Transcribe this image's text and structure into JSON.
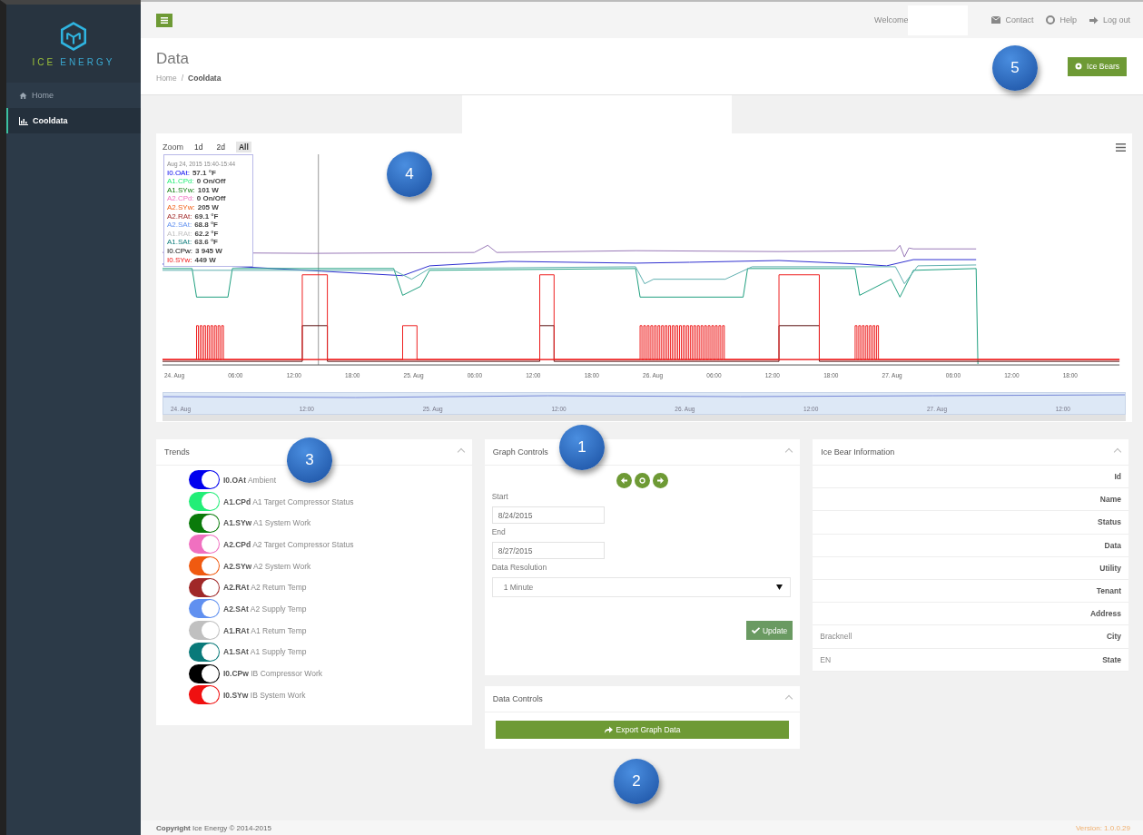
{
  "sidebar": {
    "logo": {
      "left": "ICE",
      "right": "ENERGY"
    },
    "items": [
      {
        "label": "Home",
        "selected": false
      },
      {
        "label": "Cooldata",
        "selected": true
      }
    ]
  },
  "topbar": {
    "welcome": "Welcome",
    "links": [
      {
        "label": "Contact"
      },
      {
        "label": "Help"
      },
      {
        "label": "Log out"
      }
    ]
  },
  "header": {
    "title": "Data",
    "breadcrumb": [
      "Home",
      "Cooldata"
    ],
    "breadcrumb_separator": "/",
    "button": "Ice Bears"
  },
  "chart": {
    "zoom_label": "Zoom",
    "zoom_buttons": [
      {
        "label": "1d",
        "selected": false
      },
      {
        "label": "2d",
        "selected": false
      },
      {
        "label": "All",
        "selected": true
      }
    ],
    "tooltip": {
      "title": "Aug 24, 2015 15:40-15:44",
      "rows": [
        {
          "name": "I0.OAt:",
          "value": "57.1 °F"
        },
        {
          "name": "A1.CPd:",
          "value": "0 On/Off"
        },
        {
          "name": "A1.SYw:",
          "value": "101 W"
        },
        {
          "name": "A2.CPd:",
          "value": "0 On/Off"
        },
        {
          "name": "A2.SYw:",
          "value": "205 W"
        },
        {
          "name": "A2.RAt:",
          "value": "69.1 °F"
        },
        {
          "name": "A2.SAt:",
          "value": "68.8 °F"
        },
        {
          "name": "A1.RAt:",
          "value": "62.2 °F"
        },
        {
          "name": "A1.SAt:",
          "value": "63.6 °F"
        },
        {
          "name": "I0.CPw:",
          "value": "3 945 W"
        },
        {
          "name": "I0.SYw:",
          "value": "449 W"
        }
      ]
    },
    "x_labels": [
      "24. Aug",
      "06:00",
      "12:00",
      "18:00",
      "25. Aug",
      "06:00",
      "12:00",
      "18:00",
      "26. Aug",
      "06:00",
      "12:00",
      "18:00",
      "27. Aug",
      "06:00",
      "12:00",
      "18:00"
    ],
    "navigator_labels": [
      "24. Aug",
      "12:00",
      "25. Aug",
      "12:00",
      "26. Aug",
      "12:00",
      "27. Aug",
      "12:00"
    ]
  },
  "trends": {
    "title": "Trends",
    "items": [
      {
        "code": "I0.OAt",
        "label": "Ambient",
        "color": "#0000ee",
        "on": true
      },
      {
        "code": "A1.CPd",
        "label": "A1 Target Compressor Status",
        "color": "#22ee77",
        "on": true
      },
      {
        "code": "A1.SYw",
        "label": "A1 System Work",
        "color": "#0a7a0a",
        "on": true
      },
      {
        "code": "A2.CPd",
        "label": "A2 Target Compressor Status",
        "color": "#f070c0",
        "on": true
      },
      {
        "code": "A2.SYw",
        "label": "A2 System Work",
        "color": "#f05a10",
        "on": true
      },
      {
        "code": "A2.RAt",
        "label": "A2 Return Temp",
        "color": "#a02828",
        "on": true
      },
      {
        "code": "A2.SAt",
        "label": "A2 Supply Temp",
        "color": "#6090f0",
        "on": true
      },
      {
        "code": "A1.RAt",
        "label": "A1 Return Temp",
        "color": "#c0c0c0",
        "on": true
      },
      {
        "code": "A1.SAt",
        "label": "A1 Supply Temp",
        "color": "#0a7a7a",
        "on": true
      },
      {
        "code": "I0.CPw",
        "label": "IB Compressor Work",
        "color": "#000000",
        "on": true
      },
      {
        "code": "I0.SYw",
        "label": "IB System Work",
        "color": "#f01010",
        "on": true
      }
    ]
  },
  "graph_controls": {
    "title": "Graph Controls",
    "start_label": "Start",
    "start": "8/24/2015",
    "end_label": "End",
    "end": "8/27/2015",
    "resolution_label": "Data Resolution",
    "resolution": "1 Minute",
    "update": "Update"
  },
  "data_controls": {
    "title": "Data Controls",
    "export": "Export Graph Data"
  },
  "info": {
    "title": "Ice Bear Information",
    "rows": [
      {
        "label": "Id"
      },
      {
        "label": "Name"
      },
      {
        "label": "Status"
      },
      {
        "label": "Data"
      },
      {
        "label": "Utility"
      },
      {
        "label": "Tenant"
      },
      {
        "label": "Address"
      },
      {
        "label": "City",
        "value": "Bracknell"
      },
      {
        "label": "State",
        "value": "EN"
      }
    ]
  },
  "footer": {
    "copyright": "**Copyright** Ice Energy © 2014-2015",
    "version": "Version: 1.0.0.29"
  },
  "callouts": [
    "1",
    "2",
    "3",
    "4",
    "5"
  ]
}
